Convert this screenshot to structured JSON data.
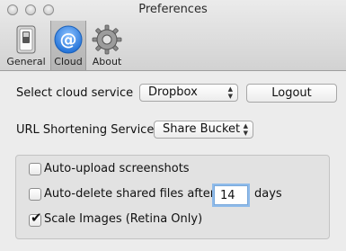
{
  "window": {
    "title": "Preferences"
  },
  "toolbar": {
    "tabs": [
      {
        "label": "General",
        "icon": "switch-icon"
      },
      {
        "label": "Cloud",
        "icon": "at-sign-icon"
      },
      {
        "label": "About",
        "icon": "gear-icon"
      }
    ],
    "active_tab": "Cloud"
  },
  "cloud": {
    "service_label": "Select cloud service",
    "service_value": "Dropbox",
    "logout_label": "Logout",
    "shortener_label": "URL Shortening Service",
    "shortener_value": "Share Bucket"
  },
  "options": {
    "auto_upload_label": "Auto-upload screenshots",
    "auto_upload_checked": false,
    "auto_delete_label": "Auto-delete shared files after",
    "auto_delete_checked": false,
    "auto_delete_days": "14",
    "days_label": "days",
    "scale_label": "Scale Images (Retina Only)",
    "scale_checked": true
  },
  "colors": {
    "accent_blue": "#3d8ee5"
  }
}
